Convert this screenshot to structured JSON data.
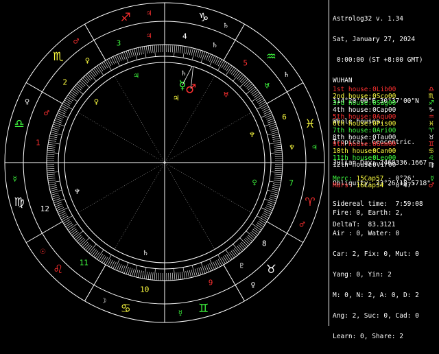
{
  "window": {
    "title": "Astrolog32 v. 1.34"
  },
  "chart_info": {
    "lines": [
      "Astrolog32 v. 1.34",
      "Sat, January 27, 2024",
      " 0:00:00 (ST +8:00 GMT)",
      "WUHAN",
      "114°20'00\"E 30°37'00\"N",
      "Whole houses.",
      "Tropical, Geocentric.",
      "Julian Day: 2460336.1667",
      "Obliquity: 23°26'18.5718\"",
      "Sidereal time:  7:59:08",
      "DeltaT:  83.3121"
    ]
  },
  "houses": [
    {
      "label": "1st house:",
      "cusp": "0Lib00",
      "color": "#ff3030",
      "sign": "♎"
    },
    {
      "label": "2nd house:",
      "cusp": "0Sco00",
      "color": "#ffff40",
      "sign": "♏"
    },
    {
      "label": "3rd house:",
      "cusp": "0Sag00",
      "color": "#40ff40",
      "sign": "♐"
    },
    {
      "label": "4th house:",
      "cusp": "0Cap00",
      "color": "#ffffff",
      "sign": "♑"
    },
    {
      "label": "5th house:",
      "cusp": "0Aqu00",
      "color": "#ff3030",
      "sign": "♒"
    },
    {
      "label": "6th house:",
      "cusp": "0Pis00",
      "color": "#ffff40",
      "sign": "♓"
    },
    {
      "label": "7th house:",
      "cusp": "0Ari00",
      "color": "#40ff40",
      "sign": "♈"
    },
    {
      "label": "8th house:",
      "cusp": "0Tau00",
      "color": "#ffffff",
      "sign": "♉"
    },
    {
      "label": "9th house:",
      "cusp": "0Gem00",
      "color": "#ff3030",
      "sign": "♊"
    },
    {
      "label": "10th house:",
      "cusp": "0Can00",
      "color": "#ffff40",
      "sign": "♋"
    },
    {
      "label": "11th house:",
      "cusp": "0Leo00",
      "color": "#40ff40",
      "sign": "♌"
    },
    {
      "label": "12th house:",
      "cusp": "0Vir00",
      "color": "#ffffff",
      "sign": "♍"
    }
  ],
  "planets": [
    {
      "name": "Merc:",
      "pos": "15Cap57",
      "speed": "- 0°26'",
      "color": "#40ff40",
      "symbol": "☿"
    },
    {
      "name": "Mars:",
      "pos": "16Cap34",
      "speed": "- 0°47'",
      "color": "#ff3030",
      "symbol": "♂"
    }
  ],
  "stats": [
    "Fire: 0, Earth: 2,",
    "Air : 0, Water: 0",
    "Car: 2, Fix: 0, Mut: 0",
    "Yang: 0, Yin: 2",
    "M: 0, N: 2, A: 0, D: 2",
    "Ang: 2, Suc: 0, Cad: 0",
    "Learn: 0, Share: 2"
  ],
  "wheel": {
    "house_numbers": [
      "1",
      "2",
      "3",
      "4",
      "5",
      "6",
      "7",
      "8",
      "9",
      "10",
      "11",
      "12"
    ],
    "house_number_colors": [
      "#ff3030",
      "#ffff40",
      "#40ff40",
      "#ffffff",
      "#ff3030",
      "#ffff40",
      "#40ff40",
      "#ffffff",
      "#ff3030",
      "#ffff40",
      "#40ff40",
      "#ffffff"
    ],
    "signs": [
      "♎",
      "♏",
      "♐",
      "♑",
      "♒",
      "♓",
      "♈",
      "♉",
      "♊",
      "♋",
      "♌",
      "♍"
    ],
    "sign_colors": [
      "#40ff40",
      "#ffff40",
      "#ff3030",
      "#ffffff",
      "#40ff40",
      "#ffff40",
      "#ff3030",
      "#ffffff",
      "#40ff40",
      "#ffff40",
      "#ff3030",
      "#ffffff"
    ],
    "rulers": [
      "♀",
      "♂",
      "♃",
      "♄",
      "♄",
      "♃",
      "♂",
      "♀",
      "☿",
      "☽",
      "☉",
      "☿"
    ],
    "ruler_colors": [
      "#ffffff",
      "#ff3030",
      "#ff3030",
      "#ffffff",
      "#ffffff",
      "#40ff40",
      "#ff3030",
      "#ffffff",
      "#40ff40",
      "#ffffff",
      "#ff3030",
      "#40ff40"
    ],
    "outer_rulers": [
      "♂",
      "♀",
      "♃",
      "♄",
      "♅",
      "♆",
      "",
      "♇",
      "",
      "",
      "",
      ""
    ],
    "outer_ruler_colors": [
      "#ff3030",
      "#ffff40",
      "#ff3030",
      "#ffffff",
      "#40ff40",
      "#ffff40",
      "#ffffff",
      "#ffffff",
      "#ffffff",
      "#ffffff",
      "#ffffff",
      "#ffffff"
    ],
    "inner_rulers": [
      "",
      "♀",
      "♃",
      "♄",
      "♅",
      "♆",
      "♀",
      "",
      "",
      "♄",
      "",
      "♆"
    ],
    "inner_ruler_colors": [
      "#ffffff",
      "#ffff40",
      "#40ff40",
      "#ffffff",
      "#ff3030",
      "#ffff40",
      "#40ff40",
      "#ffffff",
      "#ffffff",
      "#ffffff",
      "#ffffff",
      "#ffffff"
    ],
    "chart_planets": [
      {
        "symbol": "☿",
        "label": "Merc",
        "lon": 285.95,
        "color": "#40ff40"
      },
      {
        "symbol": "♂",
        "label": "Mars",
        "lon": 286.57,
        "color": "#ff3030"
      }
    ],
    "mc_marker": "♃",
    "mc_marker_color": "#ffff40"
  }
}
